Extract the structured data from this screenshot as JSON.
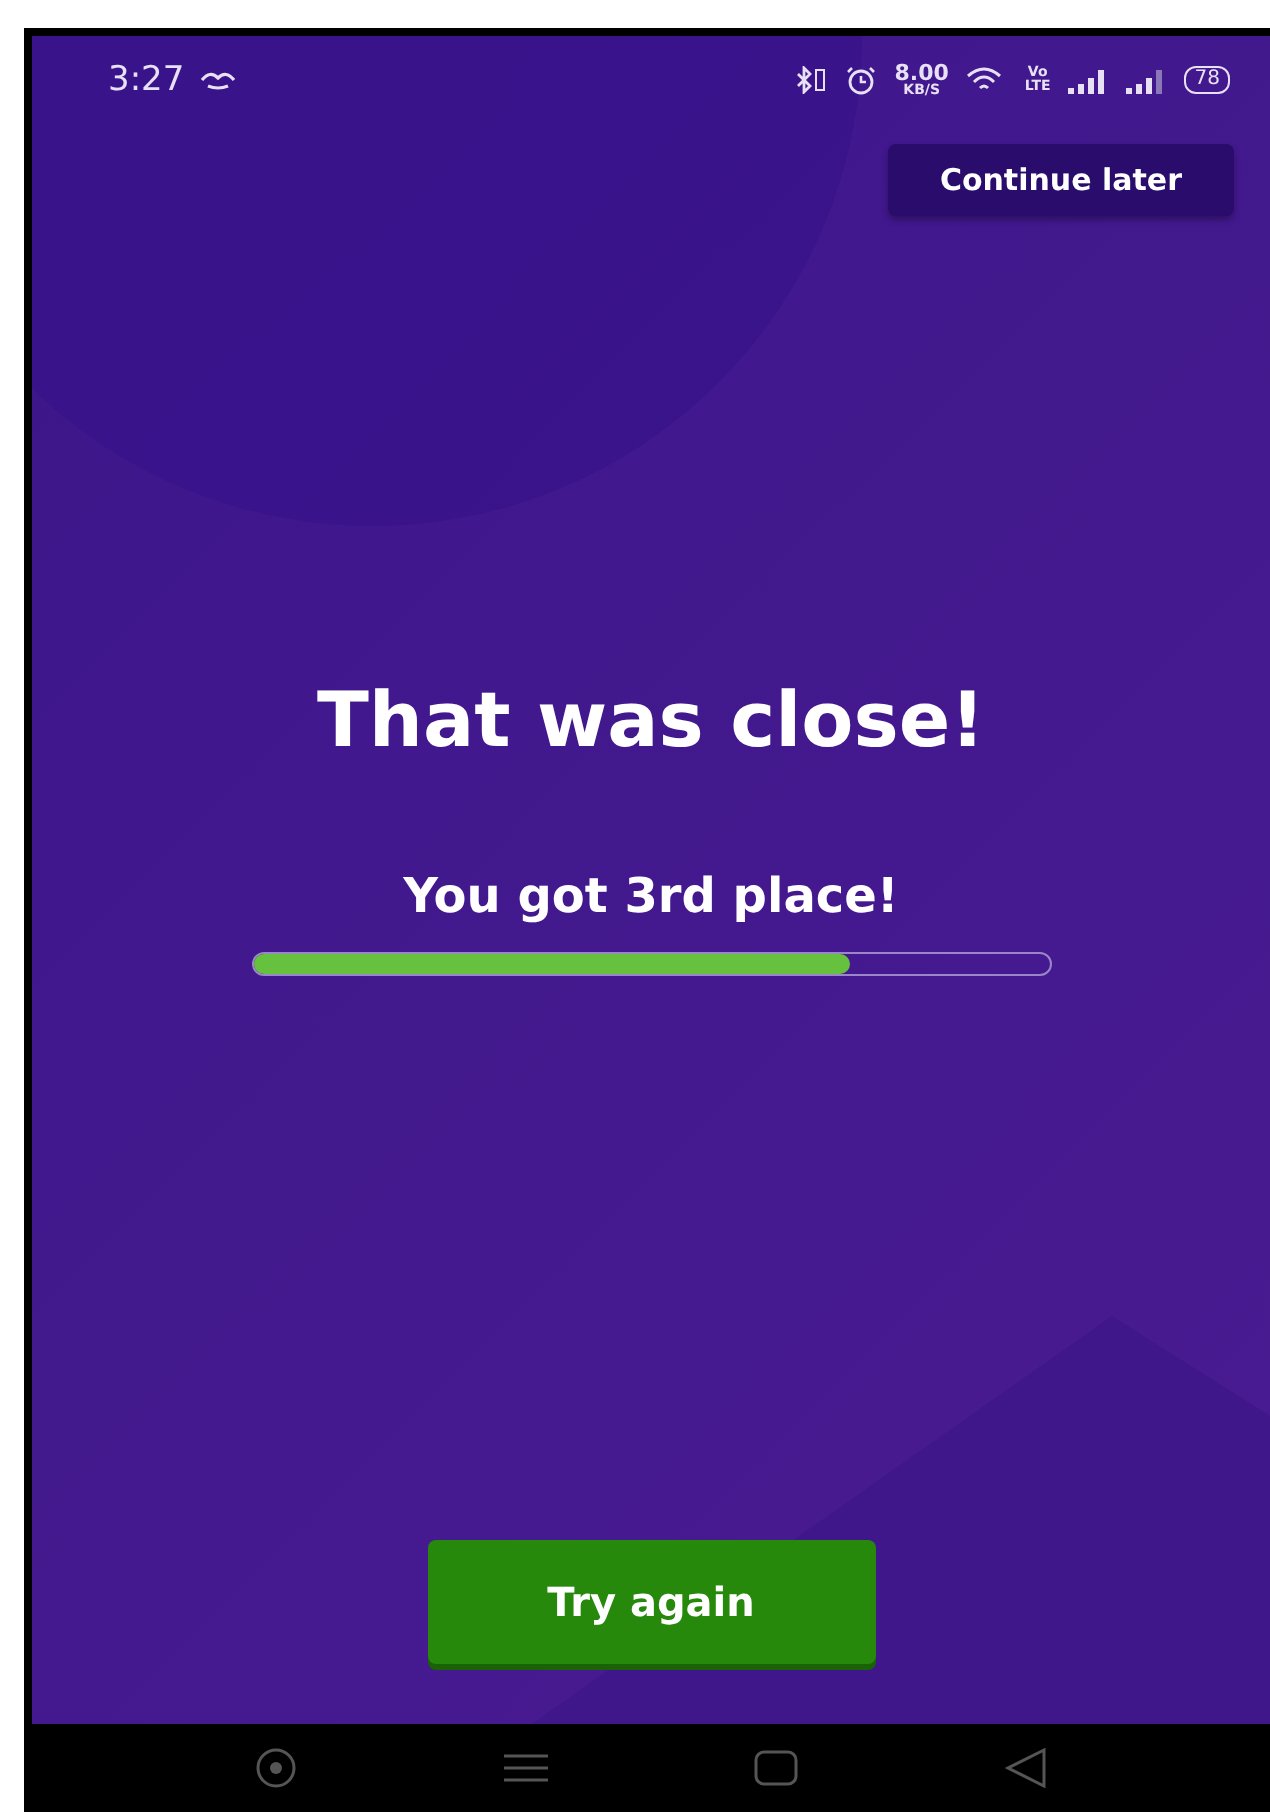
{
  "status_bar": {
    "time": "3:27",
    "speed_value": "8.00",
    "speed_unit": "KB/S",
    "volte_top": "Vo",
    "volte_bottom": "LTE",
    "battery": "78"
  },
  "continue_button": {
    "label": "Continue later"
  },
  "title": "That was close!",
  "result": {
    "text": "You got 3rd place!",
    "level": 0.75
  },
  "try_again_button": {
    "label": "Try again"
  }
}
